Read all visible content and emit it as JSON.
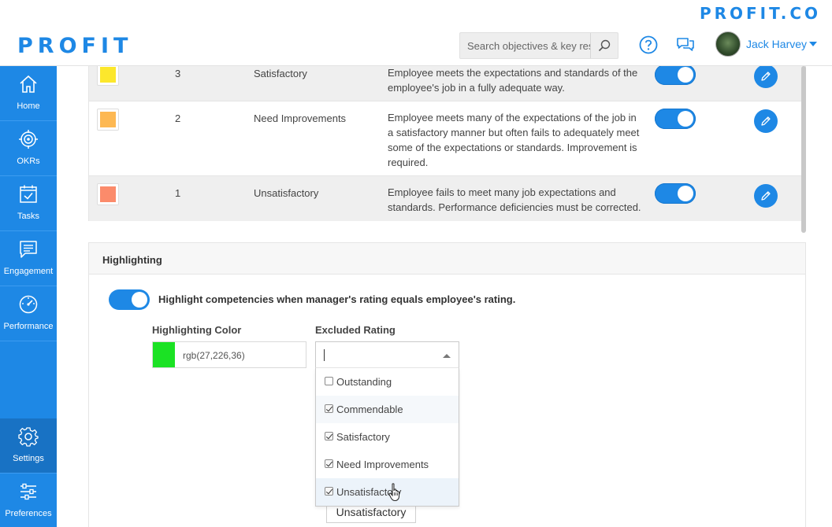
{
  "header": {
    "brand_top": "PROFIT.CO",
    "logo": "PROFIT",
    "search_placeholder": "Search objectives & key results",
    "user_name": "Jack Harvey"
  },
  "sidebar": {
    "items": [
      {
        "label": "Home",
        "icon": "home-icon"
      },
      {
        "label": "OKRs",
        "icon": "target-icon"
      },
      {
        "label": "Tasks",
        "icon": "tasks-icon"
      },
      {
        "label": "Engagement",
        "icon": "engagement-icon"
      },
      {
        "label": "Performance",
        "icon": "gauge-icon"
      },
      {
        "label": "Settings",
        "icon": "gear-icon"
      },
      {
        "label": "Preferences",
        "icon": "sliders-icon"
      }
    ]
  },
  "ratings": [
    {
      "value": "3",
      "name": "Satisfactory",
      "color": "#fce72c",
      "enabled": true,
      "description_lines": [
        "Employee meets the expectations and standards of the",
        "employee's job in a fully adequate way."
      ]
    },
    {
      "value": "2",
      "name": "Need Improvements",
      "color": "#fdb852",
      "enabled": true,
      "description_lines": [
        "Employee meets many of the expectations of the job in",
        "a satisfactory manner but often fails to adequately meet",
        "some of the expectations or standards. Improvement is",
        "required."
      ]
    },
    {
      "value": "1",
      "name": "Unsatisfactory",
      "color": "#fb8b6b",
      "enabled": true,
      "description_lines": [
        "Employee fails to meet many job expectations and",
        "standards. Performance deficiencies must be corrected."
      ]
    }
  ],
  "highlighting": {
    "title": "Highlighting",
    "toggle_enabled": true,
    "toggle_label": "Highlight competencies when manager's rating equals employee's rating.",
    "color_label": "Highlighting Color",
    "color_value": "rgb(27,226,36)",
    "color_hex": "#1be224",
    "excluded_label": "Excluded Rating",
    "options": [
      {
        "label": "Outstanding",
        "checked": false
      },
      {
        "label": "Commendable",
        "checked": true
      },
      {
        "label": "Satisfactory",
        "checked": true
      },
      {
        "label": "Need Improvements",
        "checked": true
      },
      {
        "label": "Unsatisfactory",
        "checked": true
      }
    ],
    "selected_tag": "Unsatisfactory"
  },
  "colors": {
    "accent": "#1e88e5"
  }
}
